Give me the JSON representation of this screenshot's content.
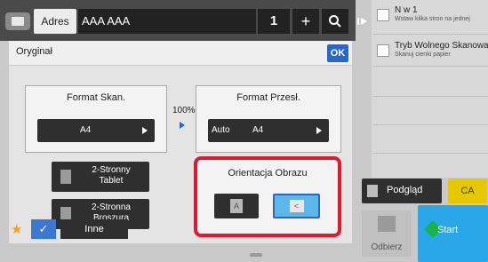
{
  "header": {
    "address_label": "Adres",
    "address_value": "AAA AAA",
    "count": "1",
    "plus": "+"
  },
  "jobs": [
    {
      "title": "N w 1",
      "subtitle": "Wstaw kilka stron na jednej"
    },
    {
      "title": "Tryb Wolnego Skanowania",
      "subtitle": "Skanuj cienki papier"
    }
  ],
  "panel": {
    "title": "Oryginał",
    "ok": "OK"
  },
  "scan_format": {
    "title": "Format Skan.",
    "value": "A4"
  },
  "ratio": "100%",
  "send_format": {
    "title": "Format Przesł.",
    "mode": "Auto",
    "value": "A4"
  },
  "duplex_tablet": "2-Stronny\nTablet",
  "duplex_booklet": "2-Stronna\nBroszura",
  "orientation": {
    "title": "Orientacja Obrazu",
    "portrait_glyph": "A",
    "landscape_glyph": "<"
  },
  "bottom": {
    "other": "Inne"
  },
  "actions": {
    "preview": "Podgląd",
    "ca": "CA",
    "receive": "Odbierz",
    "start": "Start"
  },
  "colors": {
    "accent_blue": "#2a66c8",
    "highlight_red": "#e0192e",
    "start_blue": "#2aa7e6",
    "ca_yellow": "#e6c800"
  }
}
